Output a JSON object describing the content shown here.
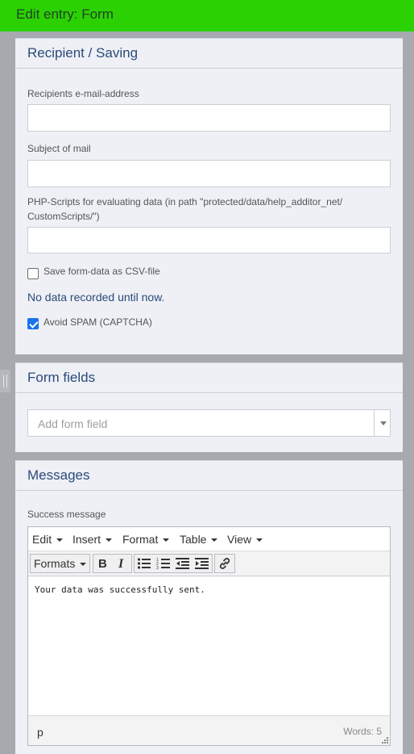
{
  "header": {
    "title": "Edit entry: Form"
  },
  "recipient": {
    "section_title": "Recipient / Saving",
    "email_label": "Recipients e-mail-address",
    "email_value": "",
    "subject_label": "Subject of mail",
    "subject_value": "",
    "scripts_label_line1": "PHP-Scripts for evaluating data (in path \"protected/data/help_additor_net/",
    "scripts_label_line2": "CustomScripts/\")",
    "scripts_value": "",
    "csv_label": "Save form-data as CSV-file",
    "csv_checked": false,
    "no_data_text": "No data recorded until now.",
    "captcha_label": "Avoid SPAM (CAPTCHA)",
    "captcha_checked": true
  },
  "form_fields": {
    "section_title": "Form fields",
    "add_placeholder": "Add form field"
  },
  "messages": {
    "section_title": "Messages",
    "success_label": "Success message",
    "editor": {
      "menu": [
        "Edit",
        "Insert",
        "Format",
        "Table",
        "View"
      ],
      "formats_label": "Formats",
      "toolbar_icons": [
        "bold-icon",
        "italic-icon",
        "bullet-list-icon",
        "numbered-list-icon",
        "outdent-icon",
        "indent-icon",
        "link-icon"
      ],
      "content": "Your data was successfully sent.",
      "path": "p",
      "word_count": "Words: 5"
    }
  },
  "colors": {
    "header_bg": "#2bd103",
    "panel_bg": "#eef0f5",
    "accent_text": "#2b4a7a",
    "checkbox_checked": "#1a73e8"
  }
}
